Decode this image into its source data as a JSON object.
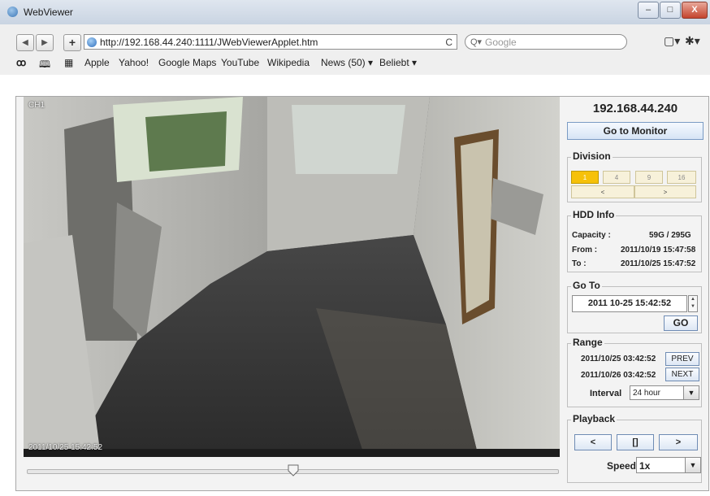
{
  "window": {
    "title": "WebViewer",
    "controls": [
      "–",
      "□",
      "X"
    ]
  },
  "toolbar": {
    "back": "◀",
    "forward": "▶",
    "add": "+",
    "url": "http://192.168.44.240:1111/JWebViewerApplet.htm",
    "reload": "C",
    "search_placeholder": "Google",
    "page_menu": "▢▾",
    "gear_menu": "✱▾"
  },
  "bookmarks": {
    "glasses": "ꝏ",
    "book": "🕮",
    "grid": "▦",
    "items": [
      "Apple",
      "Yahoo!",
      "Google Maps",
      "YouTube",
      "Wikipedia",
      "News (50) ▾",
      "Beliebt ▾"
    ]
  },
  "video": {
    "channel": "CH1",
    "timestamp": "2011/10/25 15:42:52",
    "slider_position": 0.5
  },
  "panel": {
    "ip": "192.168.44.240",
    "go_to_monitor": "Go to Monitor",
    "division": {
      "label": "Division",
      "options": [
        "1",
        "4",
        "9",
        "16"
      ],
      "prev": "<",
      "next": ">"
    },
    "hdd": {
      "label": "HDD Info",
      "capacity_label": "Capacity :",
      "capacity": "59G / 295G",
      "from_label": "From :",
      "from": "2011/10/19 15:47:58",
      "to_label": "To :",
      "to": "2011/10/25 15:47:52"
    },
    "goto": {
      "label": "Go To",
      "value": "2011 10-25 15:42:52",
      "go": "GO"
    },
    "range": {
      "label": "Range",
      "start": "2011/10/25 03:42:52",
      "prev": "PREV",
      "end": "2011/10/26 03:42:52",
      "next": "NEXT",
      "interval_label": "Interval",
      "interval": "24 hour"
    },
    "playback": {
      "label": "Playback",
      "rewind": "<",
      "pause": "[]",
      "play": ">",
      "speed_label": "Speed",
      "speed": "1x"
    }
  }
}
